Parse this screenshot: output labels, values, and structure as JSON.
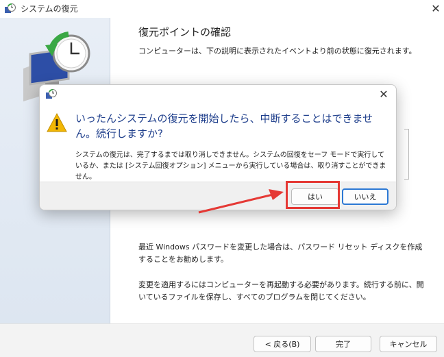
{
  "window": {
    "title": "システムの復元",
    "close_glyph": "✕",
    "page_title": "復元ポイントの確認",
    "page_description": "コンピューターは、下の説明に表示されたイベントより前の状態に復元されます。",
    "paragraph_1": "最近 Windows パスワードを変更した場合は、パスワード リセット ディスクを作成することをお勧めします。",
    "paragraph_2": "変更を適用するにはコンピューターを再起動する必要があります。続行する前に、開いているファイルを保存し、すべてのプログラムを閉じてください。",
    "buttons": {
      "back": "< 戻る(B)",
      "finish": "完了",
      "cancel": "キャンセル"
    }
  },
  "dialog": {
    "close_glyph": "✕",
    "main_instruction": "いったんシステムの復元を開始したら、中断することはできません。続行しますか?",
    "detail": "システムの復元は、完了するまでは取り消しできません。システムの回復をセーフ モードで実行しているか、または [システム回復オプション] メニューから実行している場合は、取り消すことができません。",
    "buttons": {
      "yes": "はい",
      "no": "いいえ"
    },
    "icon": "warning-icon"
  },
  "annotation": {
    "color": "#e53935",
    "target": "はい"
  },
  "colors": {
    "accent": "#2b78d4",
    "instruction_text": "#1f3f8c",
    "warning": "#f2b705"
  }
}
